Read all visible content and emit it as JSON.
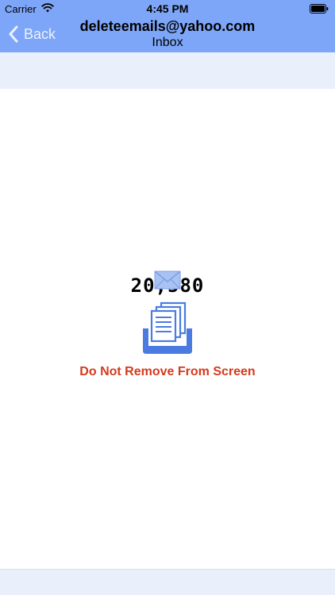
{
  "status_bar": {
    "carrier": "Carrier",
    "time": "4:45 PM"
  },
  "nav": {
    "back_label": "Back",
    "title": "deleteemails@yahoo.com",
    "subtitle": "Inbox"
  },
  "main": {
    "count": "20,580",
    "warning": "Do Not Remove From Screen"
  },
  "icons": {
    "status": [
      "wifi-icon",
      "battery-icon"
    ],
    "nav": [
      "chevron-left-icon"
    ],
    "content": [
      "envelope-icon",
      "document-tray-icon"
    ]
  },
  "colors": {
    "header": "#7ea6f8",
    "band": "#e9effb",
    "warning": "#d63a1c",
    "tray": "#4a7be0"
  }
}
